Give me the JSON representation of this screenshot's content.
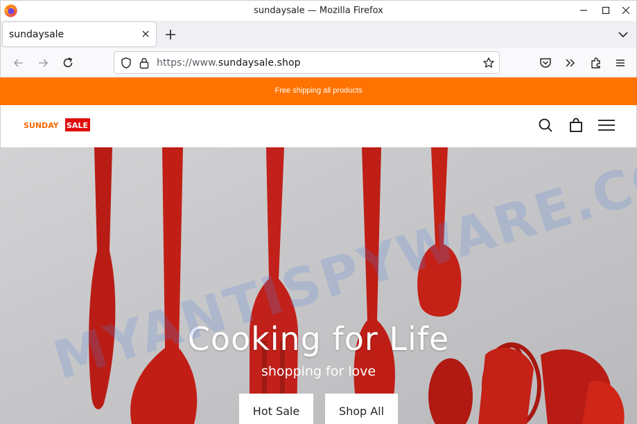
{
  "window": {
    "title": "sundaysale — Mozilla Firefox"
  },
  "tabs": [
    {
      "label": "sundaysale",
      "active": true
    }
  ],
  "navbar": {
    "url_prefix": "https://www.",
    "url_domain": "sundaysale.shop"
  },
  "site": {
    "promo_text": "Free shipping all products",
    "logo_word1": "SUNDAY",
    "logo_word2": "SALE",
    "hero": {
      "title": "Cooking for Life",
      "subtitle": "shopping for love",
      "buttons": [
        "Hot Sale",
        "Shop All"
      ]
    }
  },
  "watermark": "MYANTISPYWARE.COM",
  "colors": {
    "promo_bar": "#ff7300",
    "utensil_red": "#c51f17",
    "hero_bg": "#c9c9cb",
    "logo_orange": "#f26a00",
    "logo_red": "#e00d0d"
  },
  "icons": {
    "titlebar": [
      "firefox-logo-icon",
      "minimize-icon",
      "maximize-icon",
      "close-icon"
    ],
    "navbar": [
      "back-arrow-icon",
      "forward-arrow-icon",
      "reload-icon",
      "shield-icon",
      "lock-icon",
      "star-icon",
      "pocket-icon",
      "overflow-chevron-icon",
      "extensions-icon",
      "hamburger-menu-icon"
    ],
    "site_header": [
      "search-icon",
      "shopping-bag-icon",
      "menu-icon"
    ]
  }
}
